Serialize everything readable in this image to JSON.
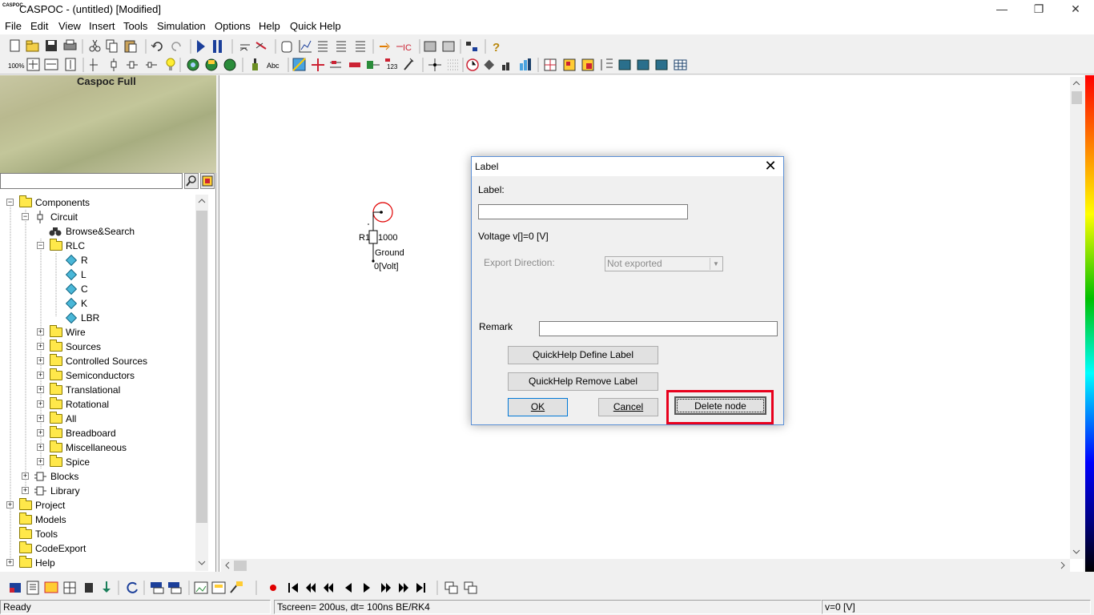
{
  "window": {
    "title": "CASPOC - (untitled) [Modified]",
    "icon_text": "CASPOC",
    "minimize_glyph": "—",
    "restore_glyph": "❐",
    "close_glyph": "✕"
  },
  "menu": [
    "File",
    "Edit",
    "View",
    "Insert",
    "Tools",
    "Simulation",
    "Options",
    "Help",
    "Quick Help"
  ],
  "toolbar2": {
    "zoom_label": "100%",
    "abc_label": "Abc",
    "counter_label": "123"
  },
  "left_panel": {
    "banner_title": "Caspoc Full",
    "search_value": "",
    "tree": [
      {
        "label": "Components",
        "type": "folder"
      },
      {
        "label": "Circuit",
        "type": "circuit"
      },
      {
        "label": "Browse&Search",
        "type": "binoculars"
      },
      {
        "label": "RLC",
        "type": "folder"
      },
      {
        "label": "R",
        "type": "component"
      },
      {
        "label": "L",
        "type": "component"
      },
      {
        "label": "C",
        "type": "component"
      },
      {
        "label": "K",
        "type": "component"
      },
      {
        "label": "LBR",
        "type": "component"
      },
      {
        "label": "Wire",
        "type": "folder"
      },
      {
        "label": "Sources",
        "type": "folder"
      },
      {
        "label": "Controlled Sources",
        "type": "folder"
      },
      {
        "label": "Semiconductors",
        "type": "folder"
      },
      {
        "label": "Translational",
        "type": "folder"
      },
      {
        "label": "Rotational",
        "type": "folder"
      },
      {
        "label": "All",
        "type": "folder"
      },
      {
        "label": "Breadboard",
        "type": "folder"
      },
      {
        "label": "Miscellaneous",
        "type": "folder"
      },
      {
        "label": "Spice",
        "type": "folder"
      },
      {
        "label": "Blocks",
        "type": "blocks"
      },
      {
        "label": "Library",
        "type": "blocks"
      },
      {
        "label": "Project",
        "type": "folder"
      },
      {
        "label": "Models",
        "type": "folder"
      },
      {
        "label": "Tools",
        "type": "folder"
      },
      {
        "label": "CodeExport",
        "type": "folder"
      },
      {
        "label": "Help",
        "type": "folder"
      }
    ]
  },
  "circuit": {
    "resistor_name": "R1",
    "resistor_value": "1000",
    "ground_label": "Ground",
    "voltage_label": "0[Volt]"
  },
  "dialog": {
    "title": "Label",
    "label_caption": "Label:",
    "label_value": "",
    "voltage_text": "Voltage v[]=0 [V]",
    "export_direction_label": "Export Direction:",
    "export_direction_value": "Not exported",
    "remark_label": "Remark",
    "remark_value": "",
    "btn_quickhelp_define": "QuickHelp Define Label",
    "btn_quickhelp_remove": "QuickHelp Remove Label",
    "btn_ok": "OK",
    "btn_cancel": "Cancel",
    "btn_delete_node": "Delete node",
    "close_glyph": "✕"
  },
  "statusbar": {
    "ready": "Ready",
    "timing": "Tscreen= 200us, dt= 100ns BE/RK4",
    "voltage": "v=0 [V]"
  },
  "colors": {
    "highlight": "#e8001c",
    "dialog_border": "#5a8fd6",
    "folder": "#ffe84a",
    "component": "#49b7d8"
  }
}
